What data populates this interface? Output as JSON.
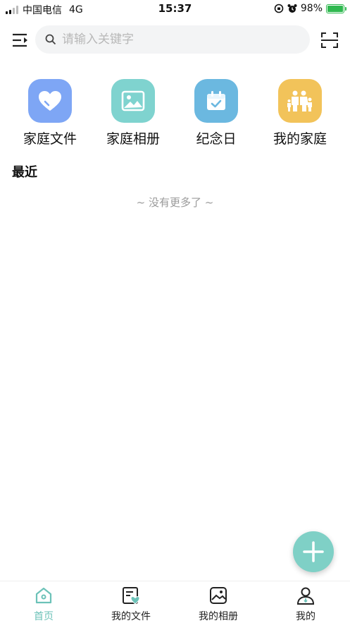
{
  "status_bar": {
    "carrier": "中国电信",
    "network": "4G",
    "time": "15:37",
    "battery": "98%",
    "battery_level": 0.98
  },
  "header": {
    "search_placeholder": "请输入关键字",
    "menu_icon": "menu-collapse-icon",
    "scan_icon": "scan-icon"
  },
  "quick_actions": [
    {
      "label": "家庭文件",
      "icon": "heart-icon",
      "color": "#7ea6f5"
    },
    {
      "label": "家庭相册",
      "icon": "image-icon",
      "color": "#7fd3cf"
    },
    {
      "label": "纪念日",
      "icon": "calendar-icon",
      "color": "#6bb8e0"
    },
    {
      "label": "我的家庭",
      "icon": "family-icon",
      "color": "#f2c35a"
    }
  ],
  "recent": {
    "title": "最近",
    "empty_text": "~ 没有更多了 ~"
  },
  "fab": {
    "icon": "plus-icon",
    "color": "#7fd0c6"
  },
  "tabs": [
    {
      "label": "首页",
      "icon": "home-icon",
      "active": true
    },
    {
      "label": "我的文件",
      "icon": "file-heart-icon",
      "active": false
    },
    {
      "label": "我的相册",
      "icon": "photo-icon",
      "active": false
    },
    {
      "label": "我的",
      "icon": "user-icon",
      "active": false
    }
  ],
  "colors": {
    "accent": "#6cc2b8"
  }
}
